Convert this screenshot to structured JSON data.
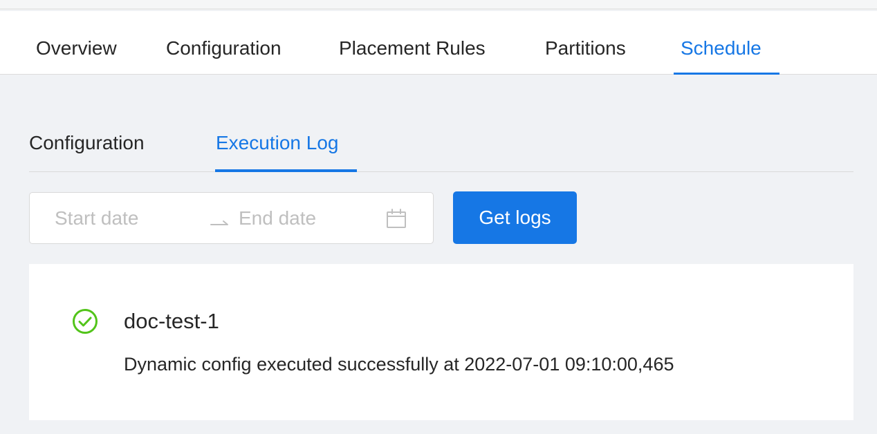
{
  "main_tabs": [
    {
      "label": "Overview",
      "active": false
    },
    {
      "label": "Configuration",
      "active": false
    },
    {
      "label": "Placement Rules",
      "active": false
    },
    {
      "label": "Partitions",
      "active": false
    },
    {
      "label": "Schedule",
      "active": true
    }
  ],
  "sub_tabs": [
    {
      "label": "Configuration",
      "active": false
    },
    {
      "label": "Execution Log",
      "active": true
    }
  ],
  "date_range": {
    "start_placeholder": "Start date",
    "end_placeholder": "End date",
    "start_value": "",
    "end_value": "",
    "separator_icon": "arrow-right-icon",
    "calendar_icon": "calendar-icon"
  },
  "get_logs_label": "Get logs",
  "logs": [
    {
      "status": "success",
      "status_icon": "check-circle-icon",
      "name": "doc-test-1",
      "message": "Dynamic config executed successfully at 2022-07-01 09:10:00,465"
    }
  ],
  "colors": {
    "accent": "#1677e5",
    "success": "#52c41a",
    "page_background": "#f0f2f5"
  }
}
